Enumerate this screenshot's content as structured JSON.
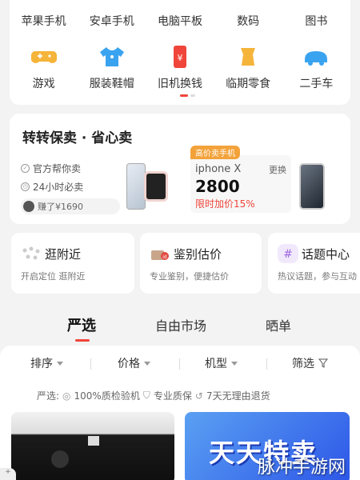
{
  "categories": {
    "row1": [
      "苹果手机",
      "安卓手机",
      "电脑平板",
      "数码",
      "图书"
    ],
    "row2": [
      {
        "label": "游戏",
        "icon": "gamepad-icon",
        "color": "#f5b43a"
      },
      {
        "label": "服装鞋帽",
        "icon": "shirt-icon",
        "color": "#3aa3f0"
      },
      {
        "label": "旧机换钱",
        "icon": "phone-yen-icon",
        "color": "#f0453a"
      },
      {
        "label": "临期零食",
        "icon": "snack-icon",
        "color": "#f5b43a"
      },
      {
        "label": "二手车",
        "icon": "car-icon",
        "color": "#3aa3f0"
      }
    ]
  },
  "sell": {
    "title": "转转保卖 · 省心卖",
    "features": [
      "官方帮你卖",
      "24小时必卖"
    ],
    "earned": "赚了¥1690",
    "tag": "高价卖手机",
    "model": "iphone X",
    "swap": "更换",
    "price": "2800",
    "bonus": "限时加价15%"
  },
  "features": [
    {
      "title": "逛附近",
      "sub": "开启定位 逛附近"
    },
    {
      "title": "鉴别估价",
      "sub": "专业鉴别，便捷估价"
    },
    {
      "title": "话题中心",
      "sub": "热议话题，参与互动"
    }
  ],
  "tabs": [
    "严选",
    "自由市场",
    "晒单"
  ],
  "filters": [
    "排序",
    "价格",
    "机型",
    "筛选"
  ],
  "strict": {
    "label": "严选:",
    "items": [
      "100%质检验机",
      "专业质保",
      "7天无理由退货"
    ]
  },
  "banner_text": "天天特卖",
  "zoom": "+",
  "watermark": "脉冲手游网",
  "colors": {
    "accent": "#f0453a",
    "orange": "#f3a23a"
  }
}
